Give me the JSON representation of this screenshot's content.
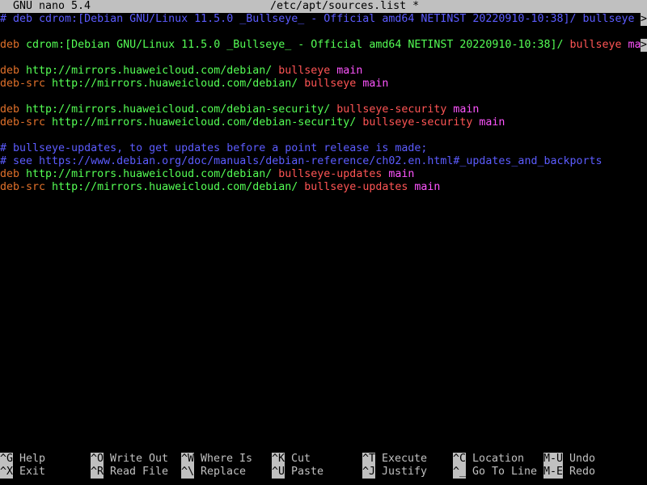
{
  "titlebar": {
    "app": "GNU nano 5.4",
    "filename": "/etc/apt/sources.list *"
  },
  "lines": [
    {
      "segments": [
        {
          "t": "# deb cdrom:[Debian GNU/Linux 11.5.0 _Bullseye_ - Official amd64 NETINST 20220910-10:38]/ bullseye ",
          "c": "comment"
        }
      ],
      "overflow": ">"
    },
    {
      "segments": []
    },
    {
      "segments": [
        {
          "t": "deb",
          "c": "kw-deb"
        },
        {
          "t": " cdrom:[Debian GNU/Linux 11.5.0 _Bullseye_ - Official amd64 NETINST 20220910-10:38]/ ",
          "c": "url"
        },
        {
          "t": "bullseye",
          "c": "suite"
        },
        {
          "t": " ma",
          "c": "comp"
        }
      ],
      "overflow": ">"
    },
    {
      "segments": []
    },
    {
      "segments": [
        {
          "t": "deb",
          "c": "kw-deb"
        },
        {
          "t": " http://mirrors.huaweicloud.com/debian/ ",
          "c": "url"
        },
        {
          "t": "bullseye",
          "c": "suite"
        },
        {
          "t": " main",
          "c": "comp"
        }
      ]
    },
    {
      "segments": [
        {
          "t": "deb-src",
          "c": "kw-src"
        },
        {
          "t": " http://mirrors.huaweicloud.com/debian/ ",
          "c": "url"
        },
        {
          "t": "bullseye",
          "c": "suite"
        },
        {
          "t": " main",
          "c": "comp"
        }
      ]
    },
    {
      "segments": []
    },
    {
      "segments": [
        {
          "t": "deb",
          "c": "kw-deb"
        },
        {
          "t": " http://mirrors.huaweicloud.com/debian-security/ ",
          "c": "url"
        },
        {
          "t": "bullseye-security",
          "c": "suite"
        },
        {
          "t": " main",
          "c": "comp"
        }
      ]
    },
    {
      "segments": [
        {
          "t": "deb-src",
          "c": "kw-src"
        },
        {
          "t": " http://mirrors.huaweicloud.com/debian-security/ ",
          "c": "url"
        },
        {
          "t": "bullseye-security",
          "c": "suite"
        },
        {
          "t": " main",
          "c": "comp"
        }
      ]
    },
    {
      "segments": []
    },
    {
      "segments": [
        {
          "t": "# bullseye-updates, to get updates before a point release is made;",
          "c": "comment"
        }
      ]
    },
    {
      "segments": [
        {
          "t": "# see https://www.debian.org/doc/manuals/debian-reference/ch02.en.html#_updates_and_backports",
          "c": "comment"
        }
      ]
    },
    {
      "segments": [
        {
          "t": "deb",
          "c": "kw-deb"
        },
        {
          "t": " http://mirrors.huaweicloud.com/debian/ ",
          "c": "url"
        },
        {
          "t": "bullseye-updates",
          "c": "suite"
        },
        {
          "t": " main",
          "c": "comp"
        }
      ]
    },
    {
      "segments": [
        {
          "t": "deb-src",
          "c": "kw-src"
        },
        {
          "t": " http://mirrors.huaweicloud.com/debian/ ",
          "c": "url"
        },
        {
          "t": "bullseye-updates",
          "c": "suite"
        },
        {
          "t": " main",
          "c": "comp"
        }
      ]
    }
  ],
  "shortcuts": {
    "row1": [
      {
        "key": "^G",
        "label": "Help"
      },
      {
        "key": "^O",
        "label": "Write Out"
      },
      {
        "key": "^W",
        "label": "Where Is"
      },
      {
        "key": "^K",
        "label": "Cut"
      },
      {
        "key": "^T",
        "label": "Execute"
      },
      {
        "key": "^C",
        "label": "Location"
      },
      {
        "key": "M-U",
        "label": "Undo"
      }
    ],
    "row2": [
      {
        "key": "^X",
        "label": "Exit"
      },
      {
        "key": "^R",
        "label": "Read File"
      },
      {
        "key": "^\\",
        "label": "Replace"
      },
      {
        "key": "^U",
        "label": "Paste"
      },
      {
        "key": "^J",
        "label": "Justify"
      },
      {
        "key": "^_",
        "label": "Go To Line"
      },
      {
        "key": "M-E",
        "label": "Redo"
      }
    ]
  }
}
